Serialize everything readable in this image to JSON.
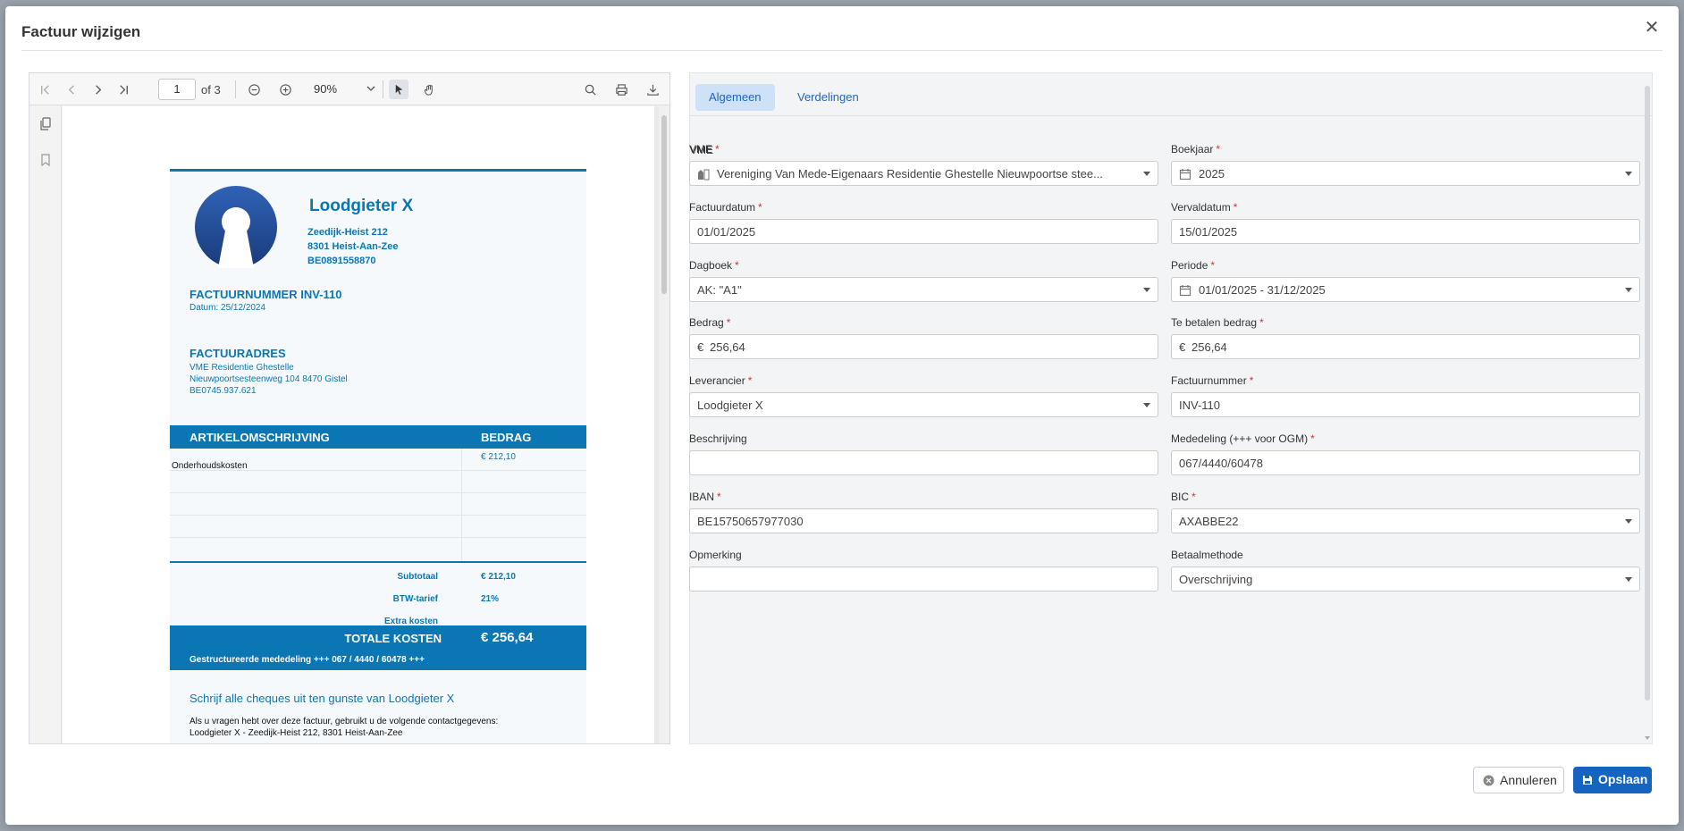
{
  "modal": {
    "title": "Factuur wijzigen",
    "close_icon": "close-icon"
  },
  "viewer": {
    "current_page": "1",
    "page_of": "of 3",
    "zoom": "90%"
  },
  "invoice": {
    "company": "Loodgieter X",
    "address": [
      "Zeedijk-Heist 212",
      "8301 Heist-Aan-Zee",
      "BE0891558870"
    ],
    "number": "FACTUURNUMMER INV-110",
    "date": "Datum: 25/12/2024",
    "billing_title": "FACTUURADRES",
    "billing_lines": [
      "VME Residentie Ghestelle",
      "Nieuwpoortsesteenweg 104 8470 Gistel",
      "BE0745.937.621"
    ],
    "col_desc": "ARTIKELOMSCHRIJVING",
    "col_amount": "BEDRAG",
    "rows": [
      {
        "desc": "Onderhoudskosten",
        "amount": "€ 212,10"
      },
      {
        "desc": "",
        "amount": ""
      },
      {
        "desc": "",
        "amount": ""
      },
      {
        "desc": "",
        "amount": ""
      },
      {
        "desc": "",
        "amount": ""
      }
    ],
    "subtotal_label": "Subtotaal",
    "subtotal_value": "€ 212,10",
    "vat_label": "BTW-tarief",
    "vat_value": "21%",
    "extra_label": "Extra kosten",
    "total_label": "TOTALE KOSTEN",
    "total_value": "€ 256,64",
    "structured": "Gestructureerde mededeling +++ 067 / 4440 / 60478 +++",
    "cheque": "Schrijf alle cheques uit ten gunste van Loodgieter X",
    "contact_lines": [
      "Als u vragen hebt over deze factuur, gebruikt u de volgende contactgegevens:",
      "Loodgieter X - Zeedijk-Heist 212, 8301 Heist-Aan-Zee"
    ]
  },
  "tabs": [
    {
      "label": "Algemeen",
      "active": true
    },
    {
      "label": "Verdelingen",
      "active": false
    }
  ],
  "form": {
    "vme": {
      "label": "VME",
      "value": "Vereniging Van Mede-Eigenaars Residentie Ghestelle Nieuwpoortse stee..."
    },
    "boekjaar": {
      "label": "Boekjaar",
      "value": "2025"
    },
    "factuurdatum": {
      "label": "Factuurdatum",
      "value": "01/01/2025"
    },
    "vervaldatum": {
      "label": "Vervaldatum",
      "value": "15/01/2025"
    },
    "dagboek": {
      "label": "Dagboek",
      "value": "AK: \"A1\""
    },
    "periode": {
      "label": "Periode",
      "value": "01/01/2025 - 31/12/2025"
    },
    "bedrag": {
      "label": "Bedrag",
      "currency": "€",
      "value": "256,64"
    },
    "te_betalen": {
      "label": "Te betalen bedrag",
      "currency": "€",
      "value": "256,64"
    },
    "leverancier": {
      "label": "Leverancier",
      "value": "Loodgieter X"
    },
    "factuurnummer": {
      "label": "Factuurnummer",
      "value": "INV-110"
    },
    "beschrijving": {
      "label": "Beschrijving",
      "value": ""
    },
    "mededeling": {
      "label": "Mededeling (+++ voor OGM)",
      "value": "067/4440/60478"
    },
    "iban": {
      "label": "IBAN",
      "value": "BE15750657977030"
    },
    "bic": {
      "label": "BIC",
      "value": "AXABBE22"
    },
    "opmerking": {
      "label": "Opmerking",
      "value": ""
    },
    "betaalmethode": {
      "label": "Betaalmethode",
      "value": "Overschrijving"
    }
  },
  "footer": {
    "cancel_label": "Annuleren",
    "save_label": "Opslaan"
  },
  "colors": {
    "primary": "#1565c0",
    "invoice_blue": "#0a77b4",
    "required": "#d33333"
  }
}
